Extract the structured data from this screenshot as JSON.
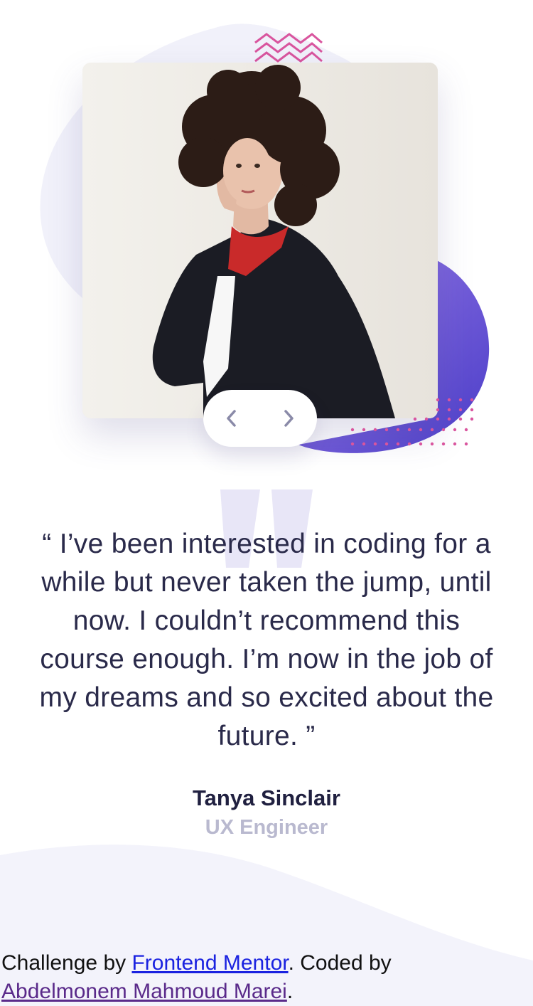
{
  "colors": {
    "accent_gradient_start": "#8b6ee4",
    "accent_gradient_end": "#4d3fc9",
    "pattern_pink": "#d9559e",
    "quote_text": "#2a2a4a",
    "author_name": "#202040",
    "author_role": "#b9b9cf",
    "background_shape": "#f1f1fa"
  },
  "slider": {
    "prev_icon": "chevron-left-icon",
    "next_icon": "chevron-right-icon"
  },
  "testimonial": {
    "quote_lines": [
      "“ I’ve been interested in coding for a",
      "while but never taken the jump, until",
      "now. I couldn’t recommend this",
      "course enough. I’m now in the job of",
      "my dreams and so excited about the",
      "future. ”"
    ],
    "author_name": "Tanya Sinclair",
    "author_role": "UX Engineer"
  },
  "attribution": {
    "prefix": "Challenge by ",
    "challenge_link": "Frontend Mentor",
    "middle": ". Coded by ",
    "author_link": "Abdelmonem Mahmoud Marei",
    "suffix": "."
  }
}
